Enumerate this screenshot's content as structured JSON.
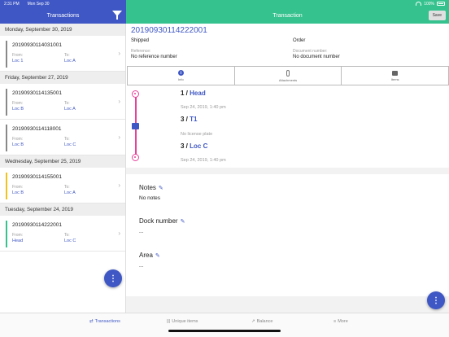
{
  "status": {
    "time": "2:31 PM",
    "date": "Mon Sep 30",
    "battery": "100%"
  },
  "left": {
    "title": "Transactions",
    "groups": [
      {
        "date": "Monday, September 30, 2019",
        "items": [
          {
            "number": "20190930114031001",
            "from_label": "From:",
            "from": "Loc 1",
            "to_label": "To:",
            "to": "Loc A",
            "color": "#888888"
          }
        ]
      },
      {
        "date": "Friday, September 27, 2019",
        "items": [
          {
            "number": "20190930114135001",
            "from_label": "From:",
            "from": "Loc B",
            "to_label": "To:",
            "to": "Loc A",
            "color": "#888888"
          },
          {
            "number": "20190930114118001",
            "from_label": "From:",
            "from": "Loc B",
            "to_label": "To:",
            "to": "Loc C",
            "color": "#888888"
          }
        ]
      },
      {
        "date": "Wednesday, September 25, 2019",
        "items": [
          {
            "number": "20190930114155001",
            "from_label": "From:",
            "from": "Loc B",
            "to_label": "To:",
            "to": "Loc A",
            "color": "#f2c21b"
          }
        ]
      },
      {
        "date": "Tuesday, September 24, 2019",
        "items": [
          {
            "number": "20190930114222001",
            "from_label": "From:",
            "from": "Head",
            "to_label": "To:",
            "to": "Loc C",
            "color": "#35c28e"
          }
        ]
      }
    ],
    "fab_icon": "more-vertical-icon",
    "fab_glyph": "⋮"
  },
  "detail": {
    "header_title": "Transaction",
    "save_label": "Save",
    "number": "20190930114222001",
    "state": "Shipped",
    "type": "Order",
    "reference_label": "Reference:",
    "reference_value": "No reference number",
    "document_label": "Document number:",
    "document_value": "No document number",
    "tabs": [
      {
        "label": "Info",
        "icon": "info-icon"
      },
      {
        "label": "Attachments",
        "icon": "paperclip-icon"
      },
      {
        "label": "Items",
        "icon": "box-icon"
      }
    ],
    "route": [
      {
        "step": "1 /",
        "location": "Head",
        "time": "Sep 24, 2019, 1:40 pm"
      },
      {
        "step": "3 /",
        "location": "T1",
        "time": "No license plate"
      },
      {
        "step": "3 /",
        "location": "Loc C",
        "time": "Sep 24, 2019, 1:40 pm"
      }
    ],
    "sections": [
      {
        "title": "Notes",
        "value": "No notes"
      },
      {
        "title": "Dock number",
        "value": "..."
      },
      {
        "title": "Area",
        "value": "..."
      }
    ],
    "fab_glyph": "⋮"
  },
  "tabbar": [
    {
      "label": "Transactions",
      "icon": "transfer-icon",
      "glyph": "⇄"
    },
    {
      "label": "Unique items",
      "icon": "barcode-icon",
      "glyph": "|||"
    },
    {
      "label": "Balance",
      "icon": "chart-icon",
      "glyph": "↗"
    },
    {
      "label": "More",
      "icon": "menu-icon",
      "glyph": "≡"
    }
  ],
  "colors": {
    "primary": "#3f57c4",
    "accent": "#35c28e",
    "route": "#e7409b"
  }
}
